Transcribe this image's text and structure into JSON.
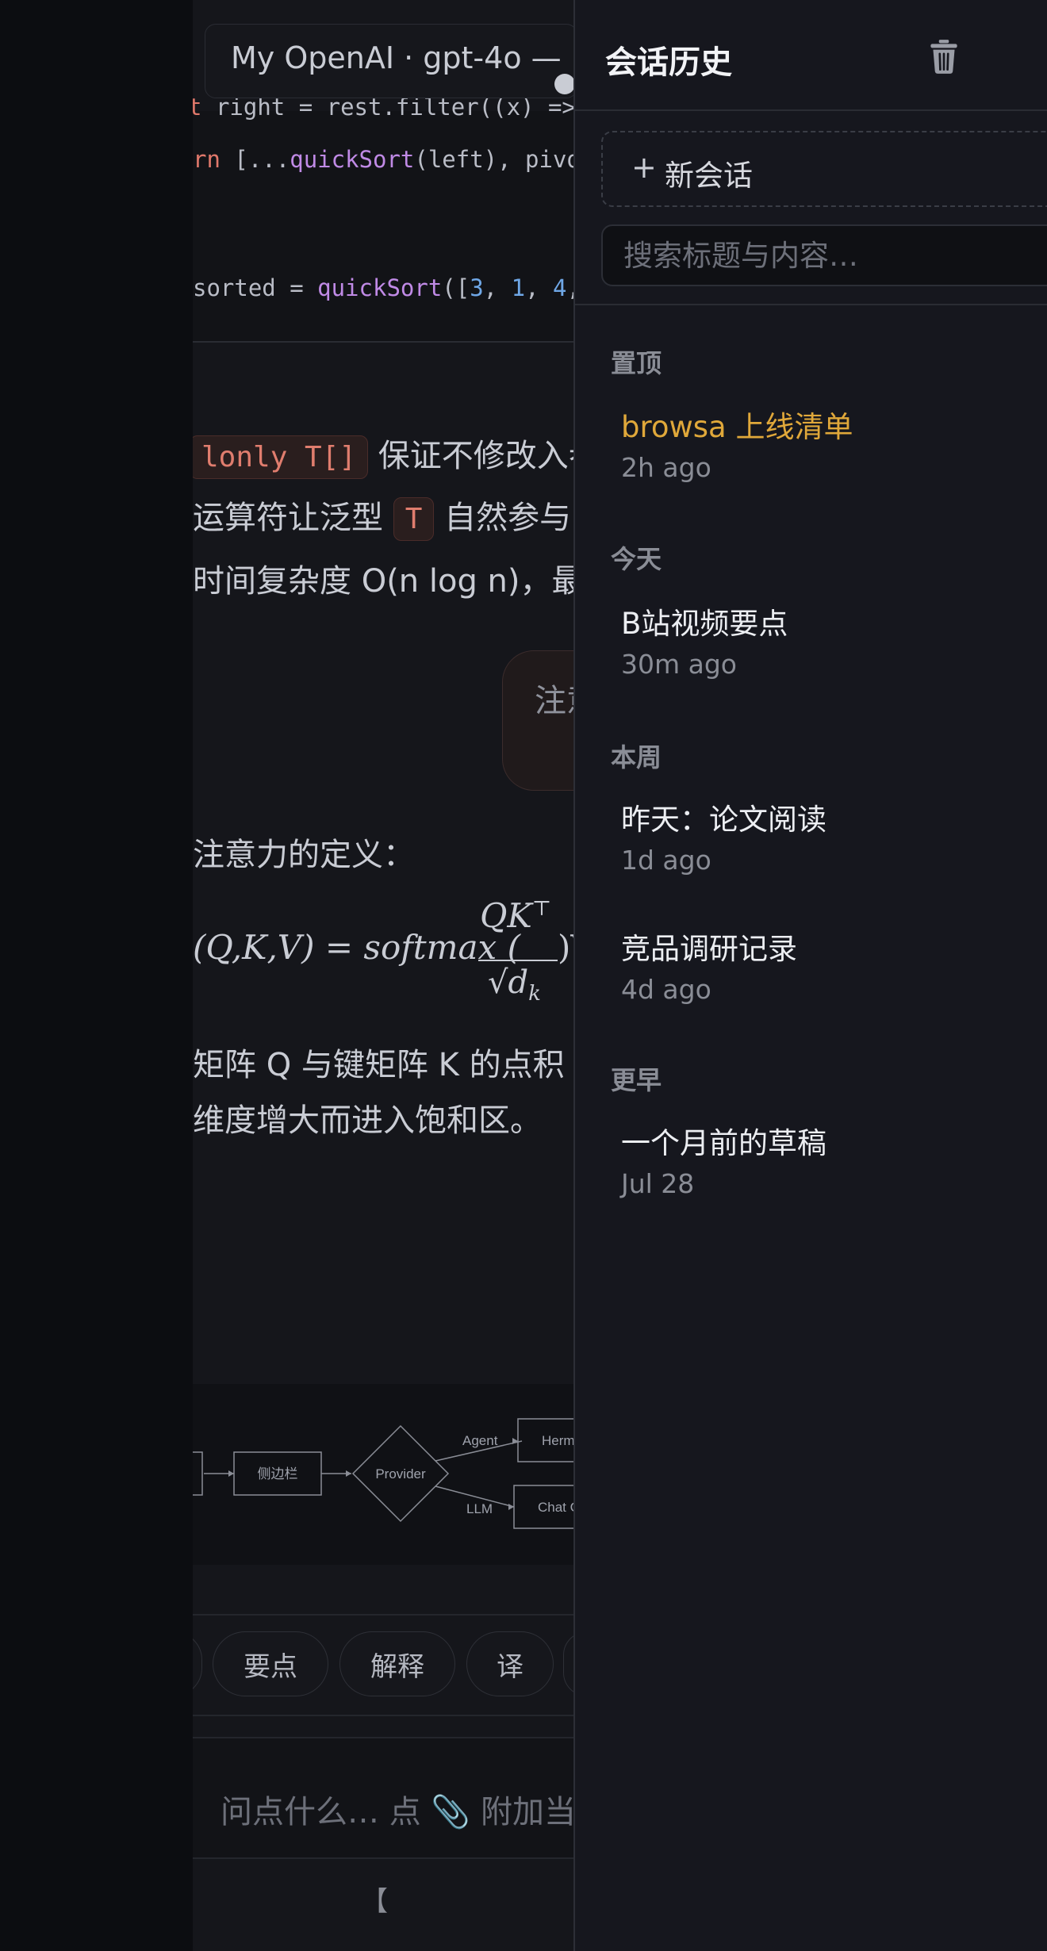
{
  "chat": {
    "title": "My OpenAI · gpt-4o —",
    "code_lines": [
      {
        "a": "right = rest.filter((x) =>",
        "b": ""
      },
      {
        "kw": "rn",
        "rest1": " [...",
        "fn": "quickSort",
        "rest2": "(left), pivo"
      },
      {
        "pre": "sorted = ",
        "fn": "quickSort",
        "open": "([",
        "n1": "3",
        "c1": ", ",
        "n2": "1",
        "c2": ", ",
        "n3": "4",
        "c3": ","
      }
    ],
    "para1_code": "lonly T[]",
    "para1_text": " 保证不修改入参",
    "para2_pre": "运算符让泛型 ",
    "para2_code": "T",
    "para2_post": " 自然参与",
    "para3": "时间复杂度 O(n log n)，最",
    "user_bubble": "注意",
    "attn_heading": "注意力的定义：",
    "math_left": "(Q,K,V) = softmax (",
    "math_num": "QK",
    "math_sup": "⊤",
    "math_den": "√d",
    "math_den_sub": "k",
    "math_right": ")V",
    "para4": "矩阵 Q 与键矩阵 K 的点积",
    "para5": "维度增大而进入饱和区。",
    "diagram": {
      "node_sidebar": "侧边栏",
      "node_provider": "Provider",
      "edge_agent": "Agent",
      "edge_llm": "LLM",
      "node_herm": "Herm",
      "node_chat": "Chat C"
    },
    "chips": [
      "要点",
      "解释",
      "译"
    ],
    "composer_placeholder": "问点什么… 点 📎 附加当",
    "footer_hint": "【"
  },
  "drawer": {
    "title": "会话历史",
    "new_chat": "新会话",
    "search_placeholder": "搜索标题与内容…",
    "sections": [
      {
        "label": "置顶",
        "items": [
          {
            "title": "browsa 上线清单",
            "time": "2h ago",
            "pinned": true
          }
        ]
      },
      {
        "label": "今天",
        "items": [
          {
            "title": "B站视频要点",
            "time": "30m ago"
          }
        ]
      },
      {
        "label": "本周",
        "items": [
          {
            "title": "昨天：论文阅读",
            "time": "1d ago"
          },
          {
            "title": "竞品调研记录",
            "time": "4d ago"
          }
        ]
      },
      {
        "label": "更早",
        "items": [
          {
            "title": "一个月前的草稿",
            "time": "Jul 28"
          }
        ]
      }
    ]
  },
  "colors": {
    "pinned": "#e0a83a",
    "accent_code": "#e07d6e",
    "fn": "#c08ae6",
    "num": "#6fa7e6"
  },
  "icons": {
    "delete": "trash-icon",
    "add": "plus-icon"
  }
}
